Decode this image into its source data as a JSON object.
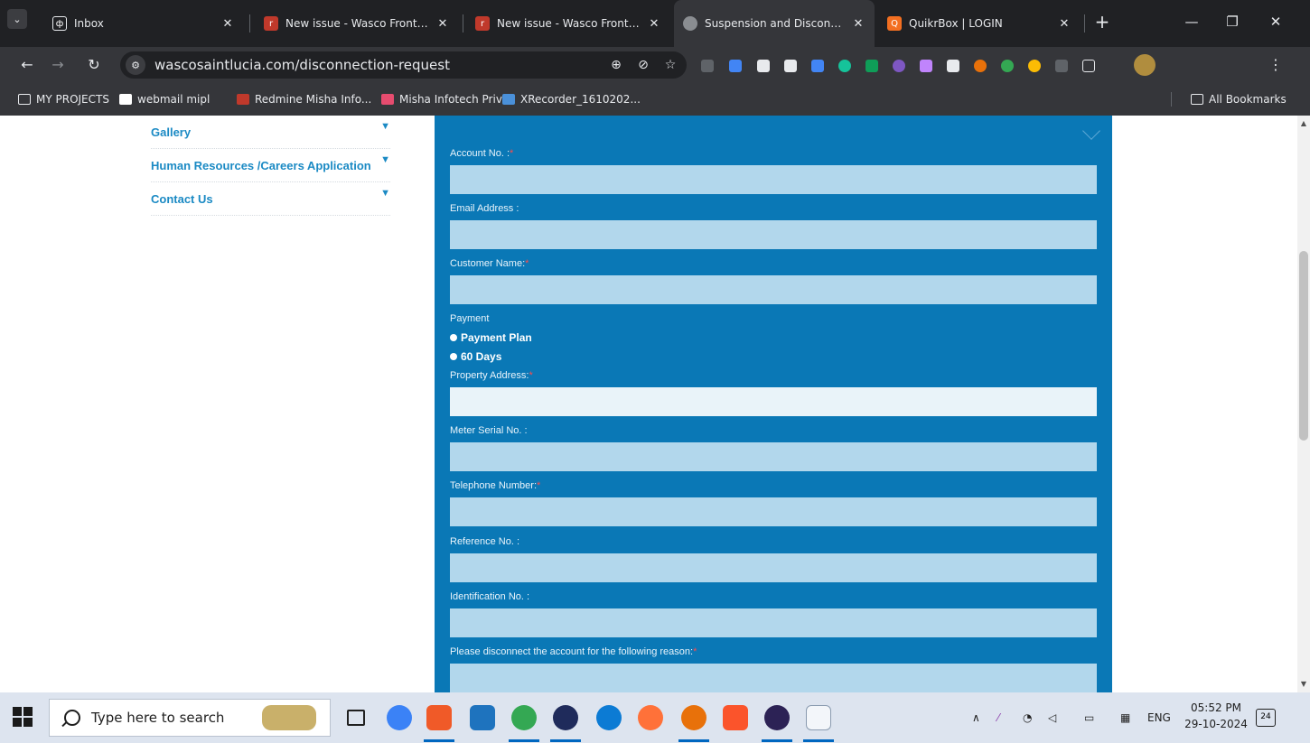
{
  "tabs": [
    {
      "title": "Inbox",
      "color": "#ffffff"
    },
    {
      "title": "New issue - Wasco Frontend",
      "color": "#c0392b"
    },
    {
      "title": "New issue - Wasco Frontend",
      "color": "#c0392b"
    },
    {
      "title": "Suspension and Disconnecti",
      "color": "#8a8d91"
    },
    {
      "title": "QuikrBox | LOGIN",
      "color": "#f36f21"
    }
  ],
  "address": {
    "url": "wascosaintlucia.com/disconnection-request"
  },
  "bookmarks": [
    {
      "label": "MY PROJECTS",
      "type": "folder"
    },
    {
      "label": "webmail mipl",
      "type": "site",
      "color": "#ffffff"
    },
    {
      "label": "Redmine Misha Info...",
      "type": "site",
      "color": "#c0392b"
    },
    {
      "label": "Misha Infotech Priv...",
      "type": "site",
      "color": "#e74c6f"
    },
    {
      "label": "XRecorder_1610202...",
      "type": "site",
      "color": "#4a90d9"
    }
  ],
  "all_bookmarks": "All Bookmarks",
  "side_menu": [
    {
      "label": "Gallery"
    },
    {
      "label": "Human Resources /Careers Application"
    },
    {
      "label": "Contact Us"
    }
  ],
  "form": {
    "account_label": "Account No. :",
    "email_label": "Email Address :",
    "customer_label": "Customer Name:",
    "payment_label": "Payment",
    "payment_options": [
      "Payment Plan",
      "60 Days"
    ],
    "property_label": "Property Address:",
    "meter_label": "Meter Serial No. :",
    "telephone_label": "Telephone Number:",
    "reference_label": "Reference No. :",
    "identification_label": "Identification No. :",
    "reason_label": "Please disconnect the account for the following reason:",
    "required_mark": "*"
  },
  "taskbar": {
    "search_placeholder": "Type here to search",
    "language": "ENG",
    "time": "05:52 PM",
    "date": "29-10-2024",
    "notification_count": "24"
  },
  "colors": {
    "panel": "#0a78b6",
    "input": "#b2d7ec",
    "input_focus": "#e9f3f9",
    "menu_link": "#1b8ac4",
    "required": "#ff4a4a"
  }
}
